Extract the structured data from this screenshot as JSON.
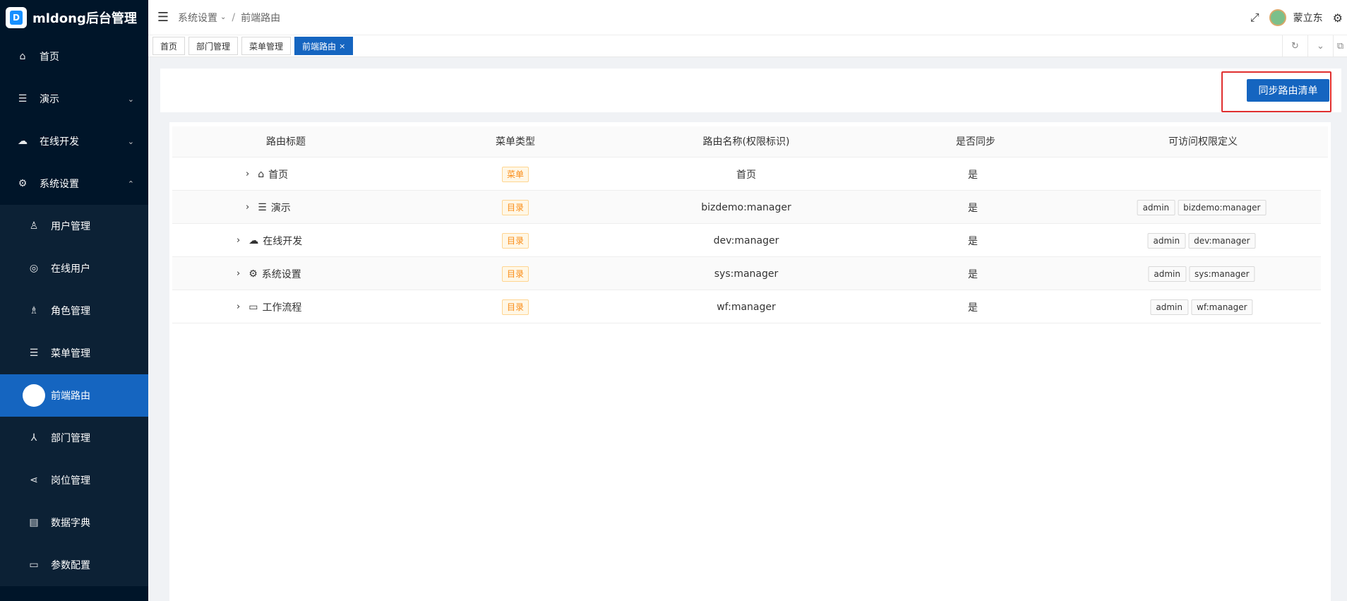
{
  "app": {
    "title": "mldong后台管理",
    "logo_letter": "D"
  },
  "sidebar": {
    "items": [
      {
        "label": "首页",
        "icon": "home-icon",
        "glyph": "⌂"
      },
      {
        "label": "演示",
        "icon": "list-icon",
        "glyph": "☰",
        "arrow": "⌄"
      },
      {
        "label": "在线开发",
        "icon": "cloud-icon",
        "glyph": "☁",
        "arrow": "⌄"
      },
      {
        "label": "系统设置",
        "icon": "gear-icon",
        "glyph": "⚙",
        "arrow": "⌃"
      }
    ],
    "sub_items": [
      {
        "label": "用户管理",
        "icon": "user-icon",
        "glyph": "♙"
      },
      {
        "label": "在线用户",
        "icon": "online-user-icon",
        "glyph": "◎"
      },
      {
        "label": "角色管理",
        "icon": "role-icon",
        "glyph": "♗"
      },
      {
        "label": "菜单管理",
        "icon": "menu-icon",
        "glyph": "☰"
      },
      {
        "label": "前端路由",
        "icon": "route-icon",
        "glyph": "",
        "active": true
      },
      {
        "label": "部门管理",
        "icon": "dept-icon",
        "glyph": "⅄"
      },
      {
        "label": "岗位管理",
        "icon": "share-icon",
        "glyph": "⋖"
      },
      {
        "label": "数据字典",
        "icon": "book-icon",
        "glyph": "▤"
      },
      {
        "label": "参数配置",
        "icon": "file-icon",
        "glyph": "▭"
      }
    ]
  },
  "header": {
    "fold_glyph": "☰",
    "breadcrumb": [
      "系统设置",
      "前端路由"
    ],
    "breadcrumb_sep": "/",
    "breadcrumb_chevron": "⌄",
    "fullscreen_glyph": "⤢",
    "user_name": "蒙立东",
    "settings_glyph": "⚙"
  },
  "tabs": [
    {
      "label": "首页"
    },
    {
      "label": "部门管理"
    },
    {
      "label": "菜单管理"
    },
    {
      "label": "前端路由",
      "active": true,
      "close": "×"
    }
  ],
  "tab_tools": [
    "↻",
    "⌄",
    "⧉"
  ],
  "toolbar": {
    "sync_label": "同步路由清单"
  },
  "table": {
    "columns": [
      "路由标题",
      "菜单类型",
      "路由名称(权限标识)",
      "是否同步",
      "可访问权限定义"
    ],
    "rows": [
      {
        "title": "首页",
        "icon": "home-icon",
        "glyph": "⌂",
        "type": "菜单",
        "name": "首页",
        "synced": "是",
        "perms": []
      },
      {
        "title": "演示",
        "icon": "list-icon",
        "glyph": "☰",
        "type": "目录",
        "name": "bizdemo:manager",
        "synced": "是",
        "perms": [
          "admin",
          "bizdemo:manager"
        ]
      },
      {
        "title": "在线开发",
        "icon": "cloud-icon",
        "glyph": "☁",
        "type": "目录",
        "name": "dev:manager",
        "synced": "是",
        "perms": [
          "admin",
          "dev:manager"
        ]
      },
      {
        "title": "系统设置",
        "icon": "gear-icon",
        "glyph": "⚙",
        "type": "目录",
        "name": "sys:manager",
        "synced": "是",
        "perms": [
          "admin",
          "sys:manager"
        ]
      },
      {
        "title": "工作流程",
        "icon": "laptop-icon",
        "glyph": "▭",
        "type": "目录",
        "name": "wf:manager",
        "synced": "是",
        "perms": [
          "admin",
          "wf:manager"
        ]
      }
    ],
    "expand_glyph": "›"
  }
}
